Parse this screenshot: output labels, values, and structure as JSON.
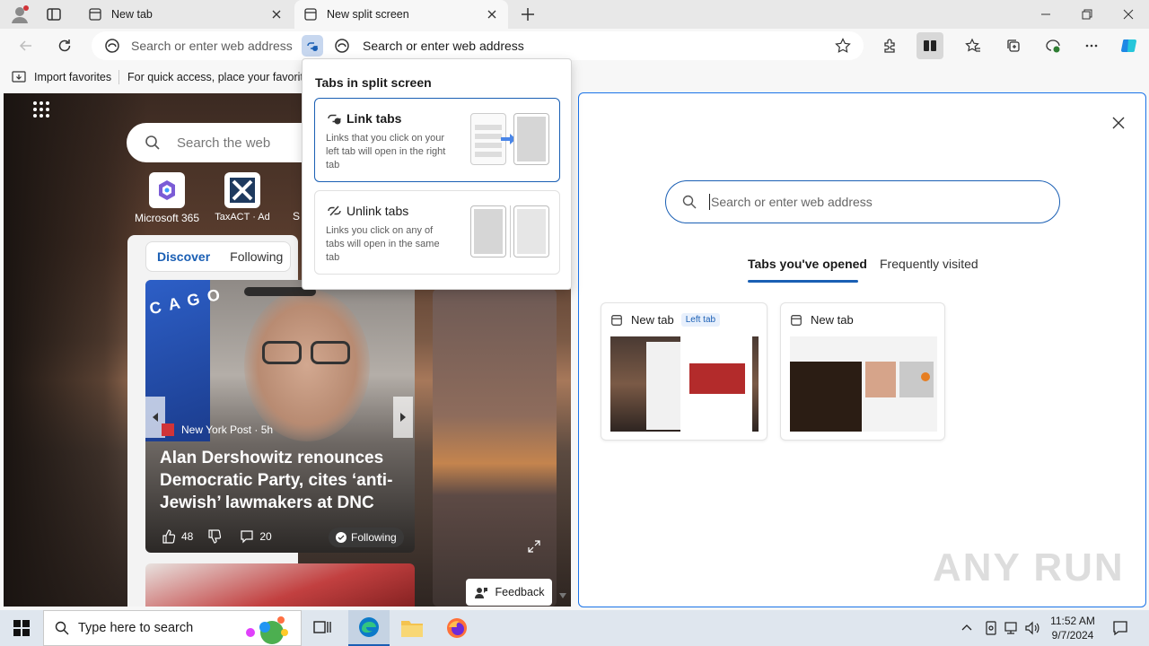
{
  "tabs": [
    {
      "title": "New tab"
    },
    {
      "title": "New split screen"
    }
  ],
  "toolbar": {
    "address_placeholder_left": "Search or enter web address",
    "address_placeholder_right": "Search or enter web address"
  },
  "favorites_bar": {
    "import_label": "Import favorites",
    "hint": "For quick access, place your favorites"
  },
  "split_popup": {
    "title": "Tabs in split screen",
    "link": {
      "title": "Link tabs",
      "desc": "Links that you click on your left tab will open in the right tab"
    },
    "unlink": {
      "title": "Unlink tabs",
      "desc": "Links you click on any of tabs will open in the same tab"
    }
  },
  "left_pane": {
    "search_placeholder": "Search the web",
    "shortcuts": [
      {
        "label": "Microsoft 365"
      },
      {
        "label": "TaxACT · Ad"
      },
      {
        "label": "S"
      }
    ],
    "feed_tabs": [
      "Discover",
      "Following"
    ],
    "story": {
      "source": "New York Post · 5h",
      "headline": "Alan Dershowitz renounces Democratic Party, cites ‘anti-Jewish’ lawmakers at DNC",
      "likes": "48",
      "comments": "20",
      "following": "Following"
    },
    "feedback": "Feedback"
  },
  "right_pane": {
    "search_placeholder": "Search or enter web address",
    "tabs": [
      "Tabs you've opened",
      "Frequently visited"
    ],
    "cards": [
      {
        "title": "New tab",
        "badge": "Left tab"
      },
      {
        "title": "New tab",
        "badge": ""
      }
    ]
  },
  "taskbar": {
    "search_placeholder": "Type here to search",
    "time": "11:52 AM",
    "date": "9/7/2024"
  },
  "watermark": "ANY RUN",
  "colors": {
    "accent": "#1a5fb4",
    "link_blue": "#1a73e8"
  }
}
